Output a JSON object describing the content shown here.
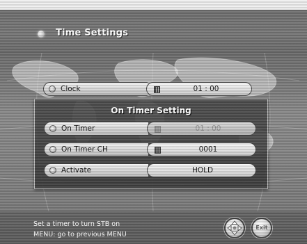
{
  "header": {
    "title": "Time Settings"
  },
  "clock_row": {
    "label": "Clock",
    "value": "01 : 00"
  },
  "on_timer_panel": {
    "title": "On Timer Setting",
    "rows": [
      {
        "label": "On Timer",
        "value": "01 : 00",
        "enabled": false
      },
      {
        "label": "On Timer CH",
        "value": "0001",
        "enabled": true
      },
      {
        "label": "Activate",
        "value": "HOLD",
        "enabled": true
      }
    ]
  },
  "footer": {
    "help_line_1": "Set a timer to turn STB on",
    "help_line_2": "MENU: go to previous MENU",
    "exit_label": "Exit"
  },
  "icons": {
    "navigate": "navigation-arrows-icon",
    "exit": "exit-icon",
    "keypad": "numeric-keypad-icon"
  }
}
